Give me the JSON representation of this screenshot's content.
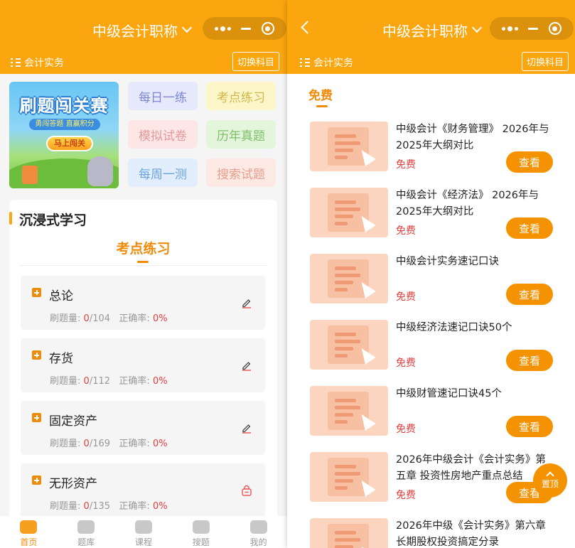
{
  "colors": {
    "brand": "#fba60f",
    "accent": "#f08b0a",
    "button": "#f59200",
    "free": "#e04040"
  },
  "left": {
    "header": {
      "title": "中级会计职称"
    },
    "subject": {
      "label": "会计实务",
      "switch_label": "切换科目"
    },
    "banner": {
      "title": "刷题闯关赛",
      "subtitle": "勇闯答题 直赢积分",
      "cta": "马上闯关"
    },
    "tiles": [
      {
        "label": "每日一练",
        "bg": "#e6e9fb",
        "fg": "#7b86d6"
      },
      {
        "label": "考点练习",
        "bg": "#fdf6c8",
        "fg": "#d1b84a"
      },
      {
        "label": "模拟试卷",
        "bg": "#fde6e6",
        "fg": "#e29a9a"
      },
      {
        "label": "历年真题",
        "bg": "#e3f6db",
        "fg": "#7fbf6a"
      },
      {
        "label": "每周一测",
        "bg": "#e2eefc",
        "fg": "#6aa3e0"
      },
      {
        "label": "搜索试题",
        "bg": "#fde9e4",
        "fg": "#e5a08e"
      }
    ],
    "section": {
      "title": "沉浸式学习",
      "tab": "考点练习"
    },
    "topics": [
      {
        "name": "总论",
        "count_label": "刷题量:",
        "done": "0",
        "total": "/104",
        "acc_label": "正确率:",
        "acc": "0%",
        "action": "pencil-icon"
      },
      {
        "name": "存货",
        "count_label": "刷题量:",
        "done": "0",
        "total": "/112",
        "acc_label": "正确率:",
        "acc": "0%",
        "action": "pencil-icon"
      },
      {
        "name": "固定资产",
        "count_label": "刷题量:",
        "done": "0",
        "total": "/169",
        "acc_label": "正确率:",
        "acc": "0%",
        "action": "pencil-icon"
      },
      {
        "name": "无形资产",
        "count_label": "刷题量:",
        "done": "0",
        "total": "/135",
        "acc_label": "正确率:",
        "acc": "0%",
        "action": "lock-icon"
      }
    ],
    "tabbar": [
      {
        "label": "首页",
        "icon": "home-icon",
        "active": true
      },
      {
        "label": "题库",
        "icon": "question-bank-icon",
        "active": false
      },
      {
        "label": "课程",
        "icon": "course-icon",
        "active": false
      },
      {
        "label": "搜题",
        "icon": "search-question-icon",
        "active": false
      },
      {
        "label": "我的",
        "icon": "profile-icon",
        "active": false
      }
    ]
  },
  "right": {
    "header": {
      "title": "中级会计职称"
    },
    "subject": {
      "label": "会计实务",
      "switch_label": "切换科目"
    },
    "tab": "免费",
    "items": [
      {
        "title": "中级会计《财务管理》 2026年与2025年大纲对比",
        "price": "免费",
        "action": "查看"
      },
      {
        "title": "中级会计《经济法》 2026年与2025年大纲对比",
        "price": "免费",
        "action": "查看"
      },
      {
        "title": "中级会计实务速记口诀",
        "price": "免费",
        "action": "查看"
      },
      {
        "title": "中级经济法速记口诀50个",
        "price": "免费",
        "action": "查看"
      },
      {
        "title": "中级财管速记口诀45个",
        "price": "免费",
        "action": "查看"
      },
      {
        "title": "2026年中级会计《会计实务》第五章 投资性房地产重点总结",
        "price": "免费",
        "action": "查看"
      },
      {
        "title": "2026年中级《会计实务》第六章 长期股权投资搞定分录",
        "price": "",
        "action": ""
      }
    ],
    "back_to_top": "置顶"
  }
}
